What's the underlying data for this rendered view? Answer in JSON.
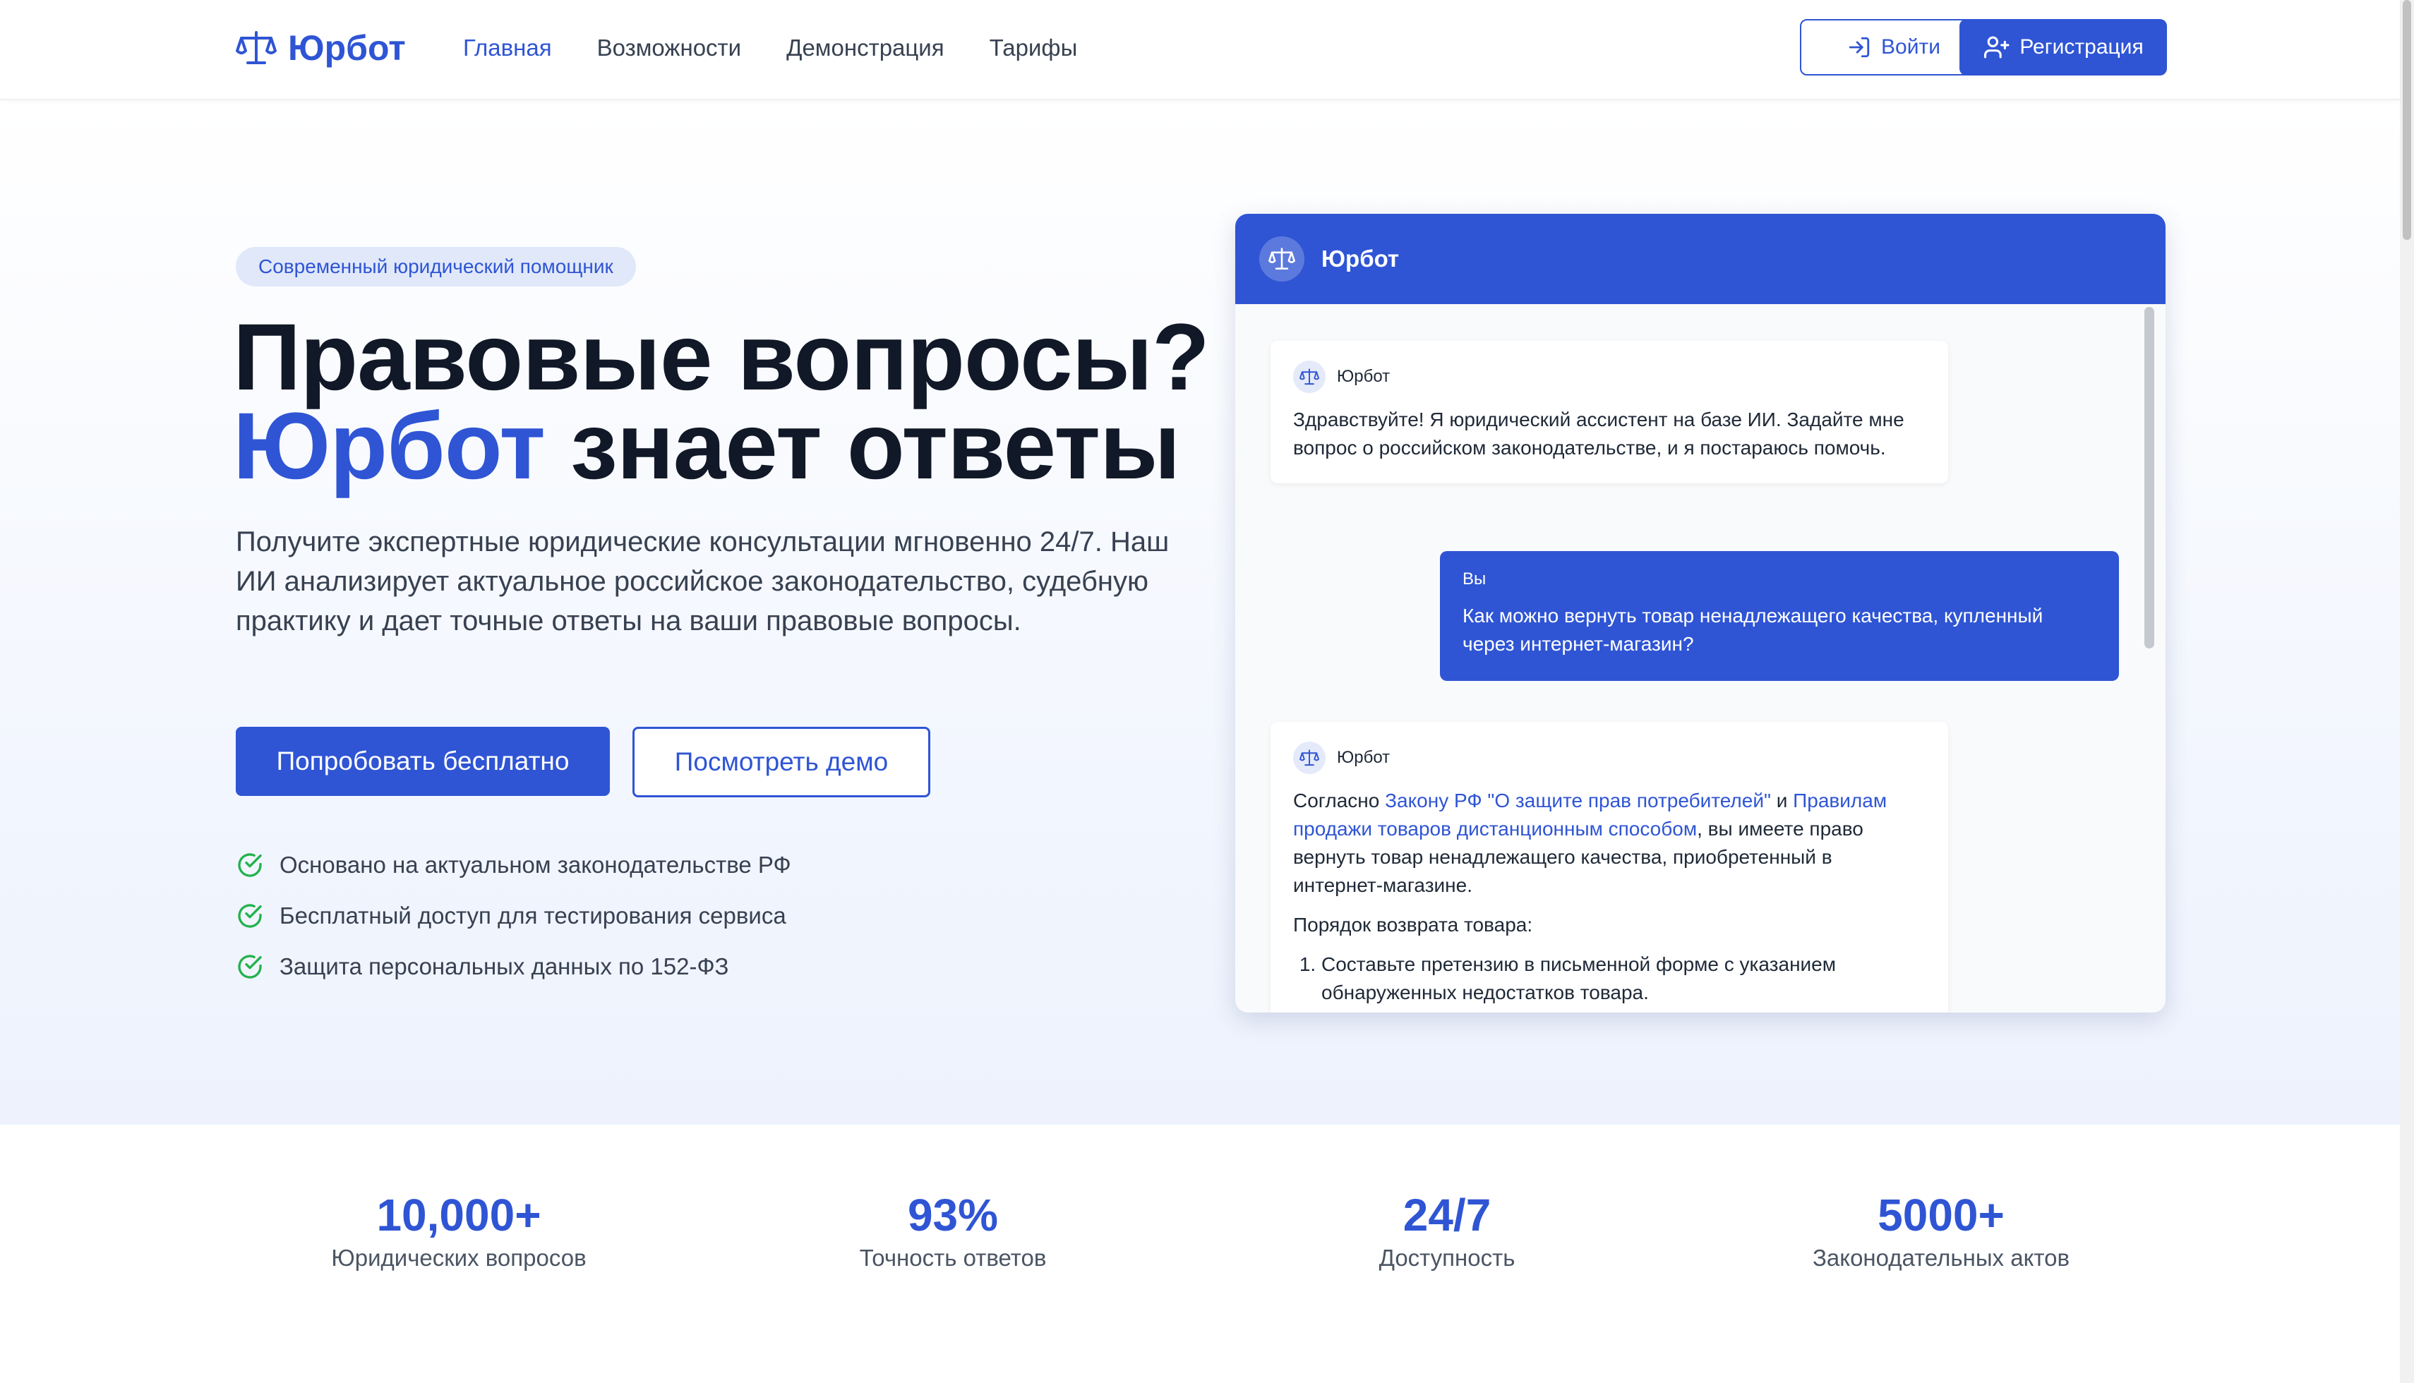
{
  "brand": {
    "name": "Юрбот",
    "color": "#2f55d4",
    "icon": "scales-icon"
  },
  "nav": [
    {
      "label": "Главная",
      "active": true
    },
    {
      "label": "Возможности",
      "active": false
    },
    {
      "label": "Демонстрация",
      "active": false
    },
    {
      "label": "Тарифы",
      "active": false
    }
  ],
  "auth": {
    "login_label": "Войти",
    "register_label": "Регистрация"
  },
  "hero": {
    "badge": "Современный юридический помощник",
    "headline_line1": "Правовые вопросы?",
    "headline_accent": "Юрбот",
    "headline_rest": " знает ответы",
    "lead": "Получите экспертные юридические консультации мгновенно 24/7. Наш ИИ анализирует актуальное российское законодательство, судебную практику и дает точные ответы на ваши правовые вопросы.",
    "primary_cta": "Попробовать бесплатно",
    "secondary_cta": "Посмотреть демо",
    "features": [
      "Основано на актуальном законодательстве РФ",
      "Бесплатный доступ для тестирования сервиса",
      "Защита персональных данных по 152-ФЗ"
    ]
  },
  "chat": {
    "title": "Юрбот",
    "bot_name": "Юрбот",
    "user_name": "Вы",
    "greeting": "Здравствуйте! Я юридический ассистент на базе ИИ. Задайте мне вопрос о российском законодательстве, и я постараюсь помочь.",
    "user_question": "Как можно вернуть товар ненадлежащего качества, купленный через интернет-магазин?",
    "answer": {
      "prefix": "Согласно ",
      "link1": "Закону РФ \"О защите прав потребителей\"",
      "middle": " и ",
      "link2": "Правилам продажи товаров дистанционным способом",
      "suffix": ", вы имеете право вернуть товар ненадлежащего качества, приобретенный в интернет-магазине.",
      "procedure_title": "Порядок возврата товара:",
      "steps": [
        "Составьте претензию в письменной форме с указанием обнаруженных недостатков товара."
      ]
    }
  },
  "stats": [
    {
      "value": "10,000+",
      "label": "Юридических вопросов"
    },
    {
      "value": "93%",
      "label": "Точность ответов"
    },
    {
      "value": "24/7",
      "label": "Доступность"
    },
    {
      "value": "5000+",
      "label": "Законодательных актов"
    }
  ]
}
